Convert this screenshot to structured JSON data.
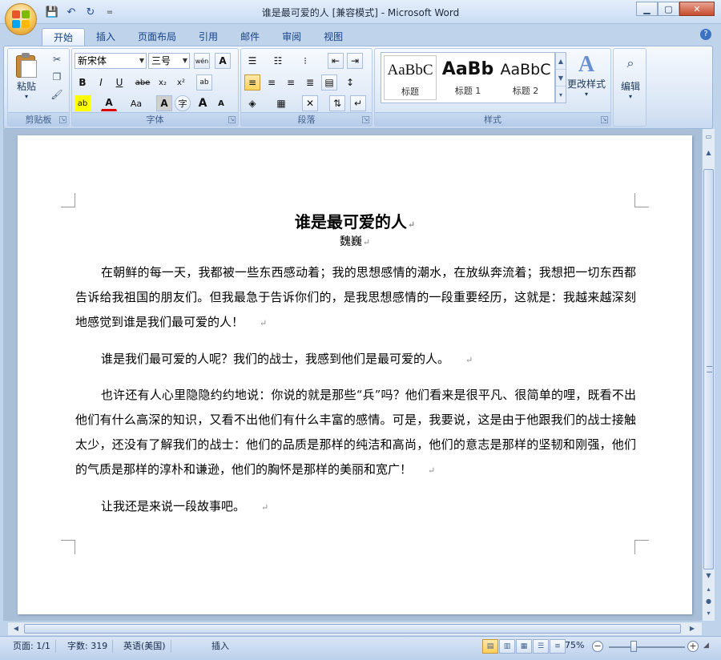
{
  "window": {
    "title": "谁是最可爱的人 [兼容模式] - Microsoft Word",
    "qat_dropdown": "="
  },
  "tabs": [
    {
      "label": "开始",
      "active": true
    },
    {
      "label": "插入"
    },
    {
      "label": "页面布局"
    },
    {
      "label": "引用"
    },
    {
      "label": "邮件"
    },
    {
      "label": "审阅"
    },
    {
      "label": "视图"
    }
  ],
  "ribbon": {
    "clipboard": {
      "label": "剪贴板",
      "paste_label": "粘贴"
    },
    "font": {
      "label": "字体",
      "font_name": "新宋体",
      "font_size": "三号",
      "bold": "B",
      "italic": "I",
      "underline": "U",
      "strike": "abe",
      "subscript": "x₂",
      "superscript": "x²",
      "grow": "A",
      "shrink": "A",
      "case": "Aa",
      "wen": "wén"
    },
    "paragraph": {
      "label": "段落"
    },
    "styles": {
      "label": "样式",
      "items": [
        {
          "sample": "AaBbC",
          "name": "标题"
        },
        {
          "sample": "AaBb",
          "name": "标题 1"
        },
        {
          "sample": "AaBbC",
          "name": "标题 2"
        }
      ],
      "change_styles": "更改样式"
    },
    "editing": {
      "label": "编辑"
    }
  },
  "document": {
    "title": "谁是最可爱的人",
    "author": "魏巍",
    "paragraphs": [
      "在朝鲜的每一天，我都被一些东西感动着；我的思想感情的潮水，在放纵奔流着；我想把一切东西都告诉给我祖国的朋友们。但我最急于告诉你们的，是我思想感情的一段重要经历，这就是：我越来越深刻地感觉到谁是我们最可爱的人！",
      "谁是我们最可爱的人呢？我们的战士，我感到他们是最可爱的人。",
      "也许还有人心里隐隐约约地说：你说的就是那些“兵”吗？他们看来是很平凡、很简单的哩，既看不出他们有什么高深的知识，又看不出他们有什么丰富的感情。可是，我要说，这是由于他跟我们的战士接触太少，还没有了解我们的战士：他们的品质是那样的纯洁和高尚，他们的意志是那样的坚韧和刚强，他们的气质是那样的淳朴和谦逊，他们的胸怀是那样的美丽和宽广！",
      "让我还是来说一段故事吧。"
    ],
    "paragraph_mark": "↵"
  },
  "statusbar": {
    "page": "页面: 1/1",
    "words": "字数: 319",
    "language": "英语(美国)",
    "mode": "插入",
    "zoom": "75%",
    "zoom_level_percent": 75
  }
}
